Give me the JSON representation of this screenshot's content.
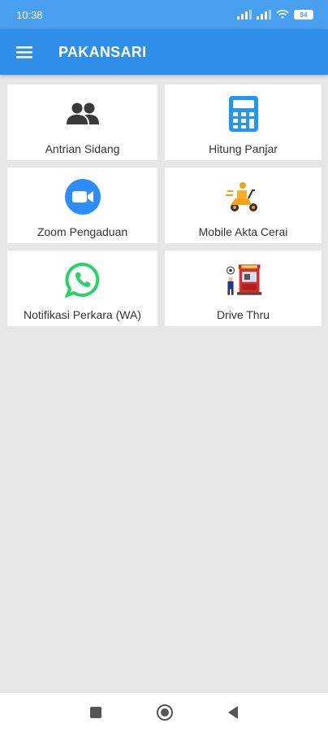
{
  "status_bar": {
    "time": "10:38",
    "battery": "84",
    "icons": [
      "signal-icon",
      "signal-icon",
      "wifi-icon",
      "battery-icon"
    ]
  },
  "app_bar": {
    "title": "PAKANSARI",
    "menu_icon": "hamburger-menu-icon"
  },
  "menu": {
    "items": [
      {
        "label": "Antrian Sidang",
        "icon": "people-icon"
      },
      {
        "label": "Hitung Panjar",
        "icon": "calculator-icon"
      },
      {
        "label": "Zoom Pengaduan",
        "icon": "zoom-video-icon"
      },
      {
        "label": "Mobile Akta Cerai",
        "icon": "delivery-scooter-icon"
      },
      {
        "label": "Notifikasi Perkara (WA)",
        "icon": "whatsapp-icon"
      },
      {
        "label": "Drive Thru",
        "icon": "drive-thru-booth-icon"
      }
    ]
  },
  "nav_bar": {
    "buttons": [
      "recents-square-icon",
      "home-circle-icon",
      "back-triangle-icon"
    ]
  },
  "colors": {
    "status_bar": "#4aa0f0",
    "app_bar": "#2f8ee8",
    "background": "#e6e6e6",
    "card": "#ffffff",
    "zoom_blue": "#2d8cff",
    "whatsapp_green": "#25d366",
    "calculator_blue": "#2196f3"
  }
}
